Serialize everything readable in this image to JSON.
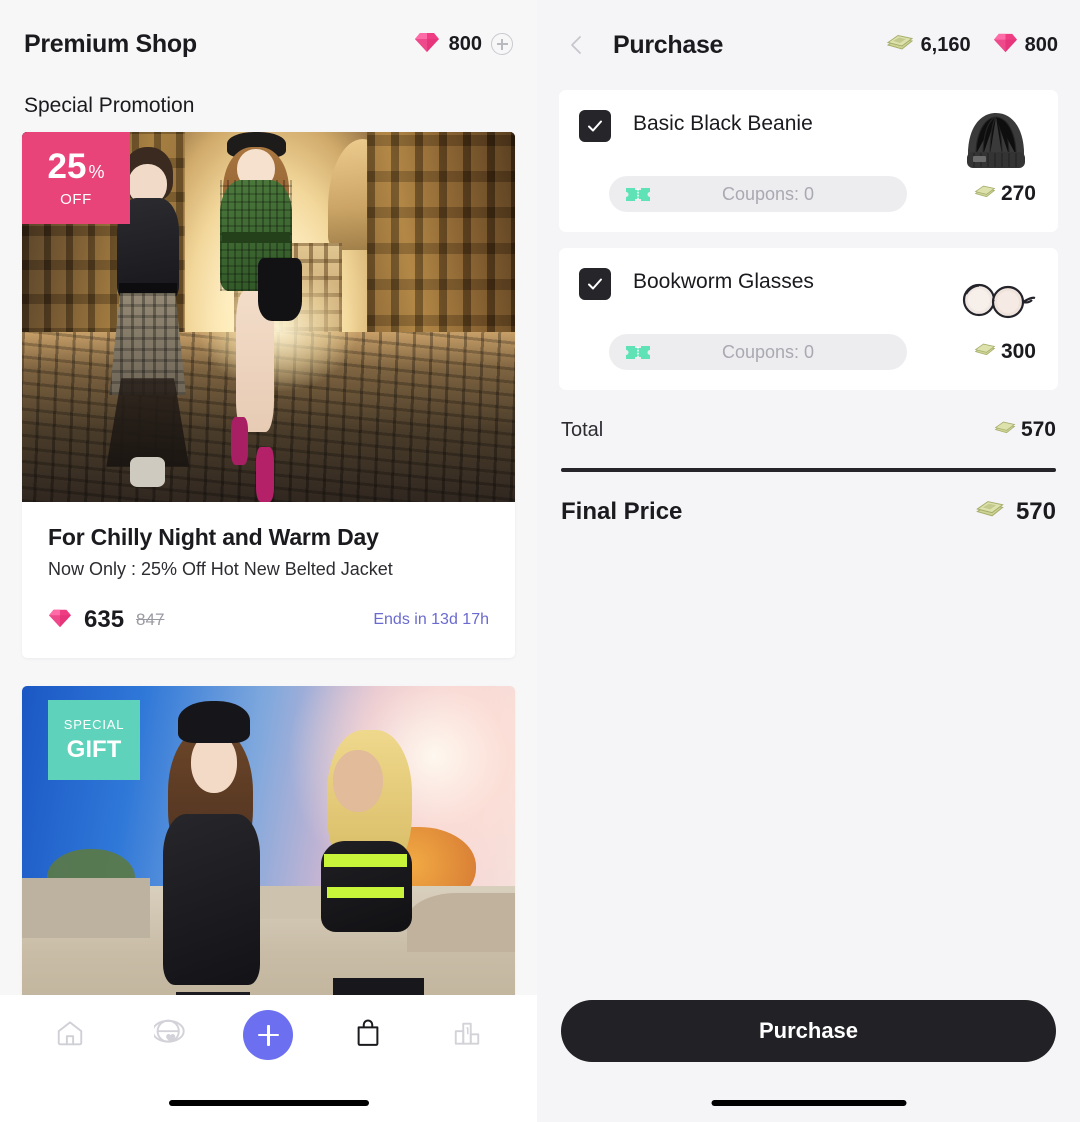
{
  "shop": {
    "title": "Premium Shop",
    "gem_balance": "800",
    "gem_icon": "diamond-icon",
    "add_icon": "plus-circle-icon",
    "section_label": "Special Promotion",
    "promotions": [
      {
        "badge_type": "discount",
        "badge_number": "25",
        "badge_percent": "%",
        "badge_off": "OFF",
        "headline": "For Chilly Night and Warm Day",
        "subtext": "Now Only : 25% Off Hot New Belted Jacket",
        "price_current": "635",
        "price_original": "847",
        "price_icon": "diamond-icon",
        "ends_in": "Ends in 13d 17h",
        "artwork": "european-street-avatars"
      },
      {
        "badge_type": "gift",
        "badge_line1": "SPECIAL",
        "badge_line2": "GIFT",
        "artwork": "skatepark-avatars"
      }
    ]
  },
  "nav": {
    "items": [
      {
        "icon": "home-icon",
        "label": "Home",
        "active": false
      },
      {
        "icon": "globe-heart-icon",
        "label": "Social",
        "active": false
      },
      {
        "icon": "plus-icon",
        "label": "Create",
        "active": true
      },
      {
        "icon": "shopping-bag-icon",
        "label": "Shop",
        "active": true
      },
      {
        "icon": "ranking-podium-icon",
        "label": "Ranking",
        "active": false
      }
    ]
  },
  "purchase": {
    "back_icon": "chevron-left-icon",
    "title": "Purchase",
    "money_icon": "money-stack-icon",
    "money_balance": "6,160",
    "gem_icon": "diamond-icon",
    "gem_balance": "800",
    "items": [
      {
        "checked": true,
        "name": "Basic Black Beanie",
        "thumb": "black-beanie-icon",
        "coupon_icon": "ticket-icon",
        "coupon_text": "Coupons: 0",
        "price": "270",
        "price_icon": "money-stack-icon"
      },
      {
        "checked": true,
        "name": "Bookworm Glasses",
        "thumb": "round-glasses-icon",
        "coupon_icon": "ticket-icon",
        "coupon_text": "Coupons: 0",
        "price": "300",
        "price_icon": "money-stack-icon"
      }
    ],
    "total_label": "Total",
    "total_value": "570",
    "final_label": "Final Price",
    "final_value": "570",
    "purchase_button": "Purchase"
  },
  "colors": {
    "accent_gem": "#ef3d83",
    "accent_money": "#c3cc8a",
    "badge_discount": "#e8447a",
    "badge_gift": "#5fd2bb",
    "coupon_mint": "#5fe3b6",
    "fab_blue": "#6b6ff0",
    "ends_purple": "#6a6ad0",
    "dark": "#25252a"
  }
}
